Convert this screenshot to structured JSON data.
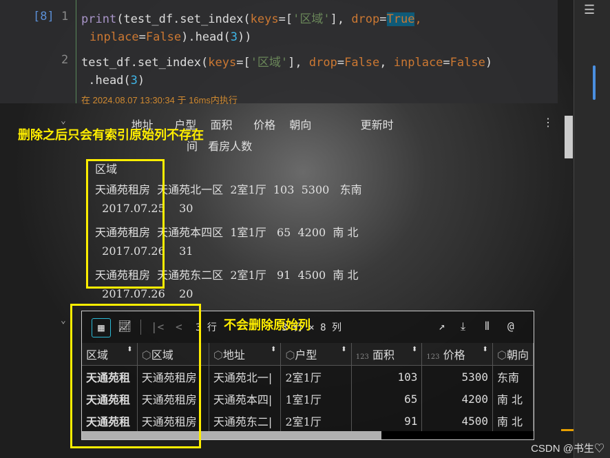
{
  "cell": {
    "exec_count": "[8]",
    "line1": "1",
    "line2": "2",
    "code1a": "print(test_df.set_index(",
    "kw_keys": "keys",
    "eq": "=",
    "lb": "[",
    "s_region": "'区域'",
    "rb": "], ",
    "kw_drop": "drop",
    "v_true": "True",
    "comma": ", ",
    "kw_inplace": "inplace",
    "v_false": "False",
    "tail1": ").head(",
    "n3": "3",
    "tail1b": "))",
    "code2a": "test_df.set_index(",
    "v_false2": "False",
    "tail2": ")",
    "code3a": " .head(",
    "tail3": ")",
    "exec_info": "在 2024.08.07 13:30:34 于 16ms内执行"
  },
  "print_output": {
    "header1": "        地址      户型    面积      价格    朝向              更新时",
    "header2": "间   看房人数",
    "index_name": "区域",
    "rows": [
      "天通苑租房  天通苑北一区  2室1厅  103  5300   东南",
      "  2017.07.25    30",
      "天通苑租房  天通苑本四区  1室1厅   65  4200  南 北",
      "  2017.07.26    31",
      "天通苑租房  天通苑东二区  2室1厅   91  4500  南 北",
      "  2017.07.26    20"
    ]
  },
  "annotations": {
    "top": "删除之后只会有索引原始列不存在",
    "bottom": "不会删除原始列"
  },
  "table": {
    "rows_select": "3 行",
    "shape": "3 行 × 8 列",
    "columns": [
      "区域",
      "区域",
      "地址",
      "户型",
      "面积",
      "价格",
      "朝向"
    ],
    "rows": [
      [
        "天通苑租",
        "天通苑租房",
        "天通苑北一|",
        "2室1厅",
        "103",
        "5300",
        "东南"
      ],
      [
        "天通苑租",
        "天通苑租房",
        "天通苑本四|",
        "1室1厅",
        "65",
        "4200",
        "南 北"
      ],
      [
        "天通苑租",
        "天通苑租房",
        "天通苑东二|",
        "2室1厅",
        "91",
        "4500",
        "南 北"
      ]
    ]
  },
  "watermark": "CSDN @书生♡",
  "colors": {
    "highlight": "#ffee00",
    "accent": "#3fb6e8"
  }
}
